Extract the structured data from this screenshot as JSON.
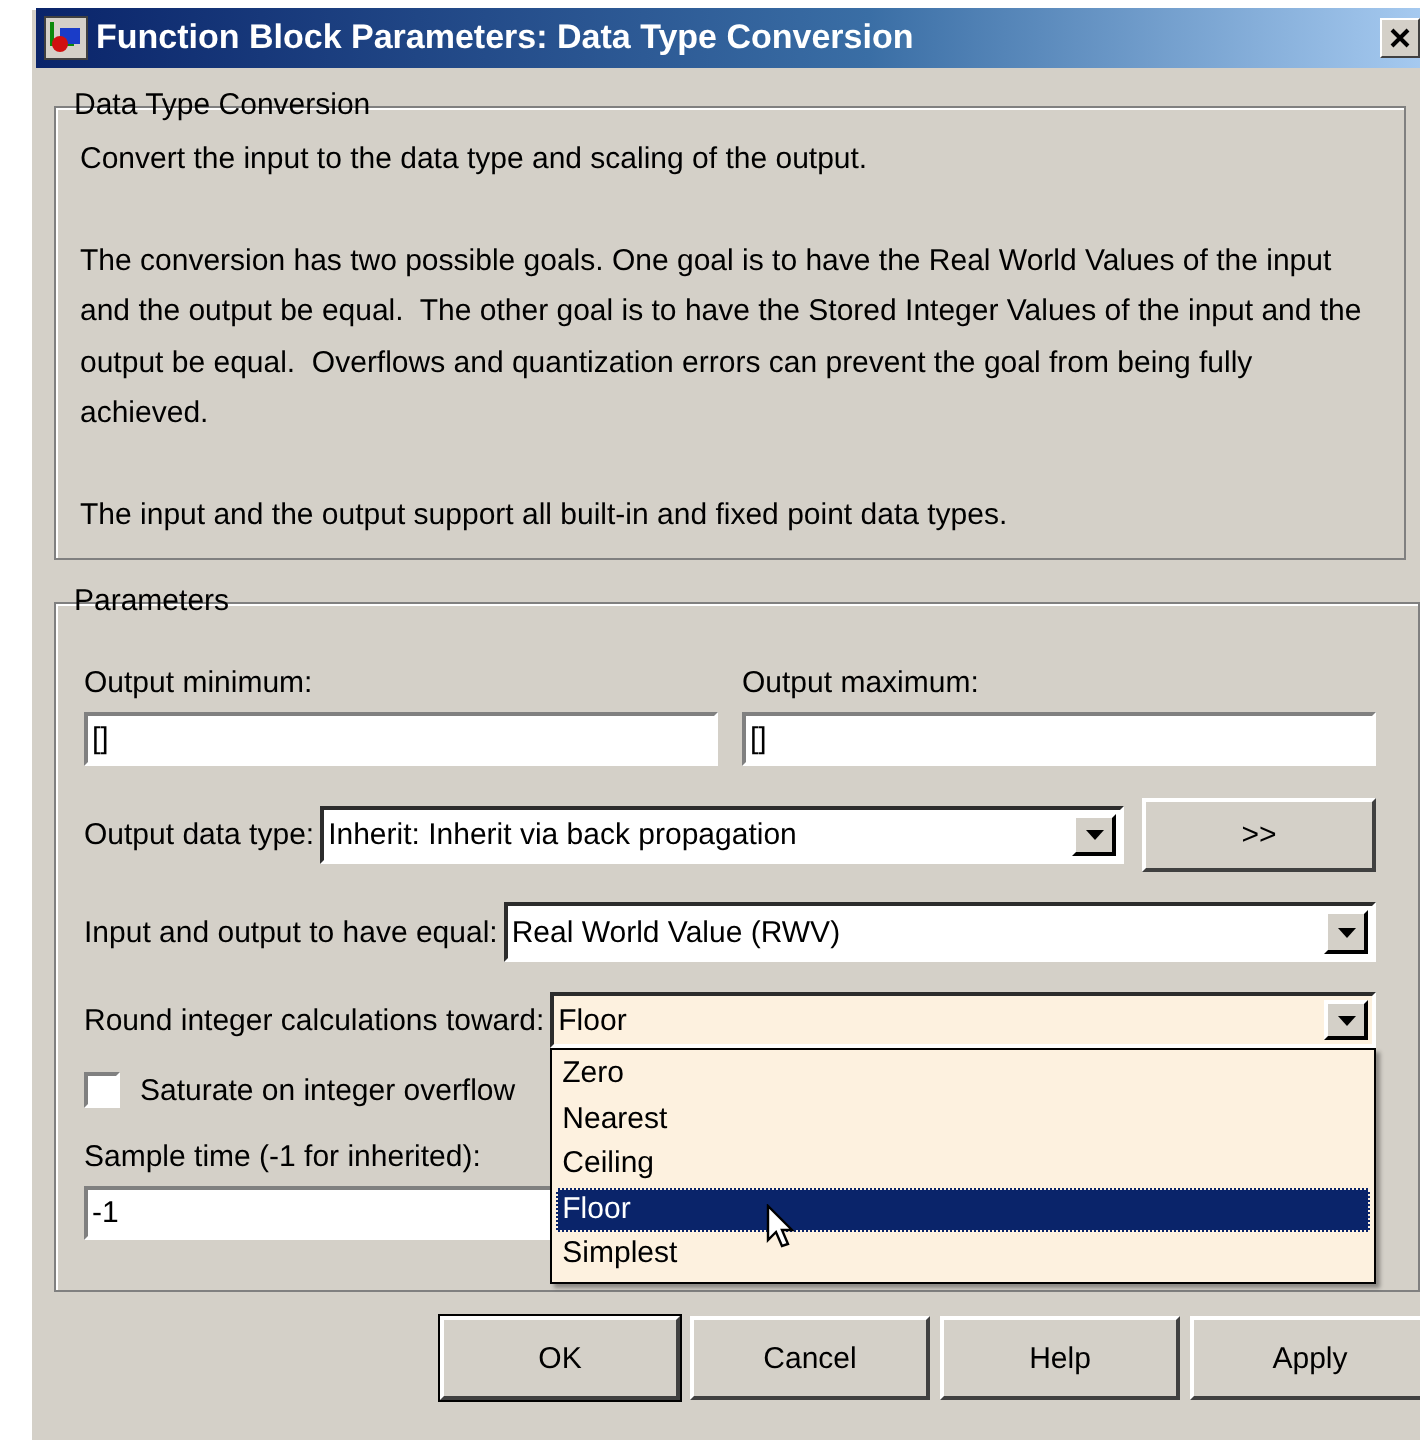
{
  "window": {
    "title": "Function Block Parameters: Data Type Conversion"
  },
  "description": {
    "title": "Data Type Conversion",
    "paragraphs": [
      "Convert the input to the data type and scaling of the output.",
      "The conversion has two possible goals. One goal is to have the Real World Values of the input and the output be equal.  The other goal is to have the Stored Integer Values of the input and the output be equal.  Overflows and quantization errors can prevent the goal from being fully achieved.",
      "The input and the output support all built-in and fixed point data types."
    ]
  },
  "parameters": {
    "title": "Parameters",
    "output_minimum": {
      "label": "Output minimum:",
      "value": "[]"
    },
    "output_maximum": {
      "label": "Output maximum:",
      "value": "[]"
    },
    "output_data_type": {
      "label": "Output data type:",
      "value": "Inherit: Inherit via back propagation",
      "expanded": false
    },
    "data_type_assistant": {
      "label": ">>"
    },
    "equal": {
      "label": "Input and output to have equal:",
      "value": "Real World Value (RWV)",
      "expanded": false
    },
    "round": {
      "label": "Round integer calculations toward:",
      "value": "Floor",
      "expanded": true,
      "options": [
        {
          "label": "Zero",
          "selected": false
        },
        {
          "label": "Nearest",
          "selected": false
        },
        {
          "label": "Ceiling",
          "selected": false
        },
        {
          "label": "Floor",
          "selected": true
        },
        {
          "label": "Simplest",
          "selected": false
        }
      ]
    },
    "saturate": {
      "label": "Saturate on integer overflow",
      "checked": false
    },
    "sample_time": {
      "label": "Sample time (-1 for inherited):",
      "value": "-1"
    }
  },
  "buttons": [
    {
      "label": "OK",
      "default": true
    },
    {
      "label": "Cancel",
      "default": false
    },
    {
      "label": "Help",
      "default": false
    },
    {
      "label": "Apply",
      "default": false
    }
  ]
}
